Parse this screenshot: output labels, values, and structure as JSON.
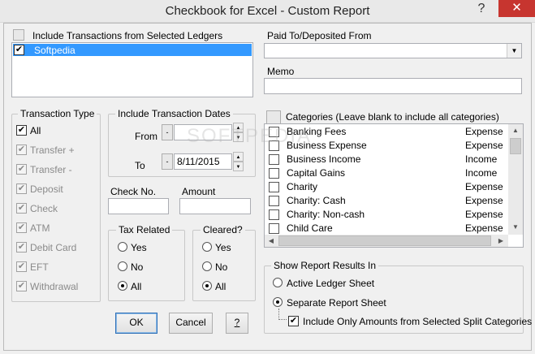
{
  "window": {
    "title": "Checkbook for Excel - Custom Report",
    "help_glyph": "?",
    "close_glyph": "✕"
  },
  "ledgers": {
    "label": "Include Transactions from Selected Ledgers",
    "items": [
      {
        "name": "Softpedia",
        "checked": true
      }
    ]
  },
  "paid_to": {
    "label": "Paid To/Deposited From",
    "value": ""
  },
  "memo": {
    "label": "Memo",
    "value": ""
  },
  "transaction_type": {
    "label": "Transaction Type",
    "items": [
      {
        "label": "All",
        "checked": true,
        "enabled": true
      },
      {
        "label": "Transfer +",
        "checked": true,
        "enabled": false
      },
      {
        "label": "Transfer -",
        "checked": true,
        "enabled": false
      },
      {
        "label": "Deposit",
        "checked": true,
        "enabled": false
      },
      {
        "label": "Check",
        "checked": true,
        "enabled": false
      },
      {
        "label": "ATM",
        "checked": true,
        "enabled": false
      },
      {
        "label": "Debit Card",
        "checked": true,
        "enabled": false
      },
      {
        "label": "EFT",
        "checked": true,
        "enabled": false
      },
      {
        "label": "Withdrawal",
        "checked": true,
        "enabled": false
      }
    ]
  },
  "dates": {
    "label": "Include Transaction Dates",
    "from_label": "From",
    "from_value": "",
    "to_label": "To",
    "to_value": "8/11/2015",
    "minus_glyph": "-"
  },
  "check_no": {
    "label": "Check No.",
    "value": ""
  },
  "amount": {
    "label": "Amount",
    "value": ""
  },
  "tax_related": {
    "label": "Tax Related",
    "options": [
      "Yes",
      "No",
      "All"
    ],
    "selected": "All"
  },
  "cleared": {
    "label": "Cleared?",
    "options": [
      "Yes",
      "No",
      "All"
    ],
    "selected": "All"
  },
  "categories": {
    "label": "Categories (Leave blank to include all categories)",
    "items": [
      {
        "name": "Banking Fees",
        "type": "Expense"
      },
      {
        "name": "Business Expense",
        "type": "Expense"
      },
      {
        "name": "Business Income",
        "type": "Income"
      },
      {
        "name": "Capital Gains",
        "type": "Income"
      },
      {
        "name": "Charity",
        "type": "Expense"
      },
      {
        "name": "Charity: Cash",
        "type": "Expense"
      },
      {
        "name": "Charity: Non-cash",
        "type": "Expense"
      },
      {
        "name": "Child Care",
        "type": "Expense"
      }
    ]
  },
  "report_results": {
    "label": "Show Report Results In",
    "options": [
      "Active Ledger Sheet",
      "Separate Report Sheet"
    ],
    "selected": "Separate Report Sheet",
    "split_label": "Include Only Amounts from Selected Split Categories",
    "split_checked": true
  },
  "buttons": {
    "ok": "OK",
    "cancel": "Cancel",
    "help": "?"
  },
  "watermark": "SOFTPEDIA",
  "icons": {
    "check": "✔",
    "dropdown": "▼",
    "up": "▲",
    "down": "▼",
    "left": "◀",
    "right": "▶"
  }
}
